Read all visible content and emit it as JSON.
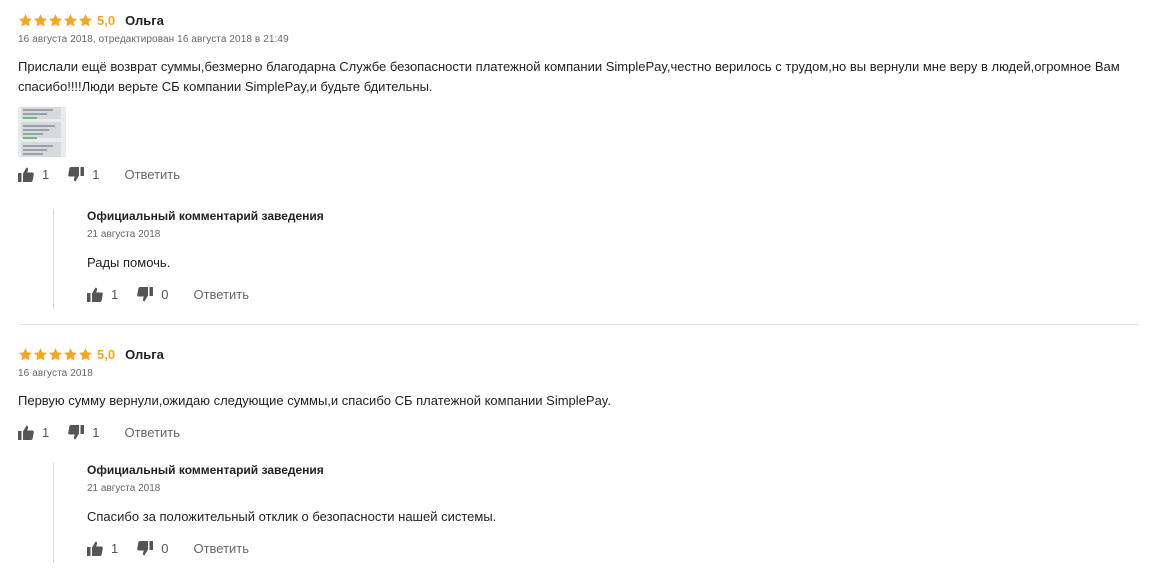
{
  "reviews": [
    {
      "stars_shown": 5,
      "score": "5,0",
      "author": "Ольга",
      "meta": "16 августа 2018, отредактирован 16 августа 2018 в 21:49",
      "text": "Прислали ещё возврат суммы,безмерно благодарна Службе безопасности платежной компании SimplePay,честно верилось с трудом,но вы вернули мне веру в людей,огромное Вам спасибо!!!!Люди верьте СБ компании SimplePay,и будьте бдительны.",
      "likes": "1",
      "dislikes": "1",
      "reply_label": "Ответить",
      "official": {
        "title": "Официальный комментарий заведения",
        "date": "21 августа 2018",
        "text": "Рады помочь.",
        "likes": "1",
        "dislikes": "0",
        "reply_label": "Ответить"
      }
    },
    {
      "stars_shown": 5,
      "score": "5,0",
      "author": "Ольга",
      "meta": "16 августа 2018",
      "text": "Первую сумму вернули,ожидаю следующие суммы,и спасибо СБ платежной компании SimplePay.",
      "likes": "1",
      "dislikes": "1",
      "reply_label": "Ответить",
      "official": {
        "title": "Официальный комментарий заведения",
        "date": "21 августа 2018",
        "text": "Спасибо за положительный отклик о безопасности нашей системы.",
        "likes": "1",
        "dislikes": "0",
        "reply_label": "Ответить"
      }
    }
  ],
  "colors": {
    "star": "#f5a623",
    "icon": "#555555",
    "divider": "#e3e3e3"
  },
  "icons": {
    "like": "thumbs-up-icon",
    "dislike": "thumbs-down-icon",
    "star": "star-icon"
  }
}
